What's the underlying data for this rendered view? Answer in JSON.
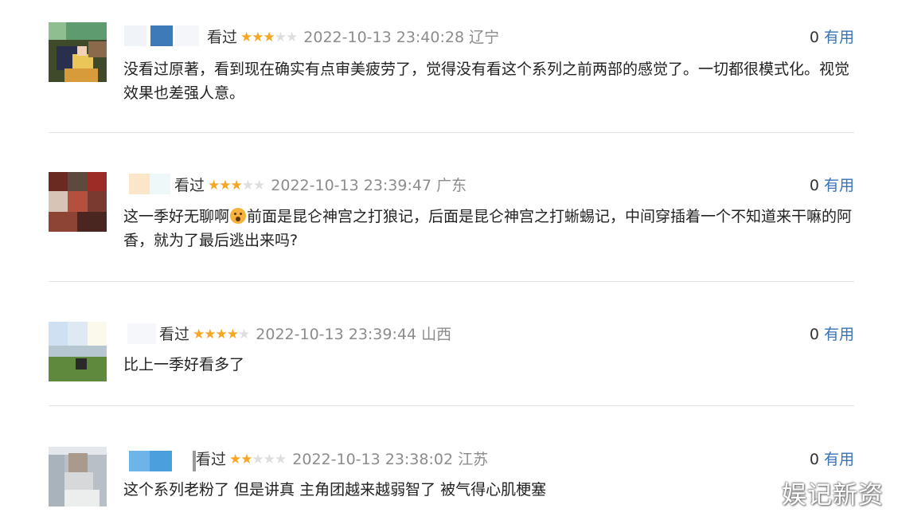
{
  "comments": [
    {
      "avatar_desc_icon": "user-avatar",
      "watched": "看过",
      "rating": 3,
      "max_rating": 5,
      "time": "2022-10-13 23:40:28",
      "location": "辽宁",
      "useful_count": "0",
      "useful_label": "有用",
      "text": "没看过原著，看到现在确实有点审美疲劳了，觉得没有看这个系列之前两部的感觉了。一切都很模式化。视觉效果也差强人意。"
    },
    {
      "avatar_desc_icon": "user-avatar",
      "watched": "看过",
      "rating": 3,
      "max_rating": 5,
      "time": "2022-10-13 23:39:47",
      "location": "广东",
      "useful_count": "0",
      "useful_label": "有用",
      "text_before": "这一季好无聊啊",
      "emoji_icon": "surprised-face-emoji",
      "text_after": "前面是昆仑神宫之打狼记，后面是昆仑神宫之打蜥蜴记，中间穿插着一个不知道来干嘛的阿香，就为了最后逃出来吗?"
    },
    {
      "avatar_desc_icon": "user-avatar",
      "watched": "看过",
      "rating": 4,
      "max_rating": 5,
      "time": "2022-10-13 23:39:44",
      "location": "山西",
      "useful_count": "0",
      "useful_label": "有用",
      "text": "比上一季好看多了"
    },
    {
      "avatar_desc_icon": "user-avatar",
      "watched": "看过",
      "rating": 2,
      "max_rating": 5,
      "time": "2022-10-13 23:38:02",
      "location": "江苏",
      "useful_count": "0",
      "useful_label": "有用",
      "text": "这个系列老粉了 但是讲真 主角团越来越弱智了 被气得心肌梗塞"
    }
  ],
  "watermark": "娱记新资",
  "colors": {
    "star_on": "#f5a623",
    "star_off": "#dedede",
    "link": "#3773b5",
    "time": "#8c8c8c"
  }
}
